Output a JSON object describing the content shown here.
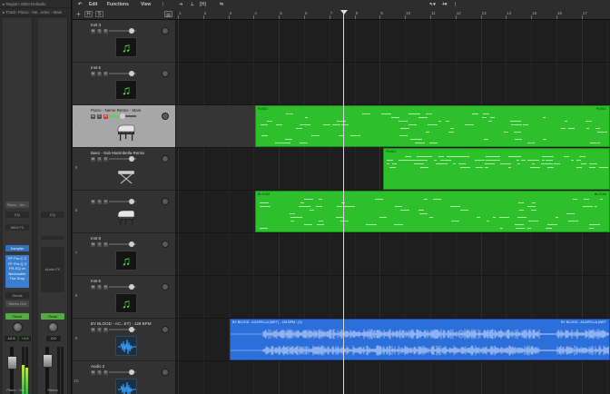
{
  "inspector": {
    "region_line": "▸ Region: MIDI Defaults",
    "track_line": "▸ Track:  Piano - Ne...emix - Main"
  },
  "channel_strips": [
    {
      "setting": "Piano - Ne...",
      "eq": "EQ",
      "midi_fx": "MIDI FX",
      "instrument": "Sampler",
      "plugins": [
        "FF Pro-C 2",
        "FF Pro-Q 3",
        "FR-EQ ch",
        "Brickwaller",
        "The Drop"
      ],
      "sends": "Sends",
      "output": "Stereo Out",
      "read": "Read",
      "volume": "-12.6",
      "pan": "+4.5",
      "name": "Piano - Nar..."
    },
    {
      "setting": "",
      "eq": "EQ",
      "midi_fx": "",
      "instrument": "Audio FX",
      "plugins": [],
      "sends": "",
      "output": "",
      "read": "Read",
      "volume": "0.0",
      "pan": "",
      "name": "Stereo"
    }
  ],
  "toolbar": {
    "menus": [
      "Edit",
      "Functions",
      "View"
    ],
    "add_track_icon": "plus-icon",
    "header_tools": [
      "H",
      "S"
    ]
  },
  "ruler": {
    "bars": [
      "1",
      "2",
      "3",
      "4",
      "5",
      "6",
      "7",
      "8",
      "9",
      "10",
      "11",
      "12",
      "13",
      "14",
      "15",
      "16",
      "17"
    ]
  },
  "tracks": [
    {
      "num": "",
      "name": "Inst 3",
      "icon": "music-note-icon"
    },
    {
      "num": "",
      "name": "Inst 5",
      "icon": "music-note-icon"
    },
    {
      "num": "4",
      "name": "Piano - Nerve Remix - Main",
      "icon": "grand-piano-icon",
      "selected": true
    },
    {
      "num": "5",
      "name": "Bass - Sub Marimbella Remix",
      "icon": "keyboard-stand-icon"
    },
    {
      "num": "6",
      "name": "",
      "icon": "grand-piano-icon"
    },
    {
      "num": "7",
      "name": "Inst 8",
      "icon": "music-note-icon"
    },
    {
      "num": "8",
      "name": "Inst 6",
      "icon": "music-note-icon"
    },
    {
      "num": "9",
      "name": "BY BLOOD - AC...ET) - 128 BPM",
      "icon": "waveform-icon"
    },
    {
      "num": "10",
      "name": "Audio 2",
      "icon": "waveform-icon"
    }
  ],
  "regions": [
    {
      "lane": 2,
      "type": "midi",
      "name": "PIANO",
      "name_right": "PIANO"
    },
    {
      "lane": 3,
      "type": "midi",
      "name": "PIANO",
      "name_right": ""
    },
    {
      "lane": 4,
      "type": "midi",
      "name": "BLOOM",
      "name_right": "BLOOM"
    },
    {
      "lane": 7,
      "type": "audio",
      "name": "BY BLOOD - ACAPELLA (WET) - 128 BPM ▫ (2)",
      "name_right": "BY BLOOD - ACAPELLA (WET"
    }
  ],
  "colors": {
    "midi_region": "#2ec02c",
    "audio_region": "#2d6fd9",
    "selected_track": "#a7a7a7",
    "background": "#1e1e1e"
  }
}
